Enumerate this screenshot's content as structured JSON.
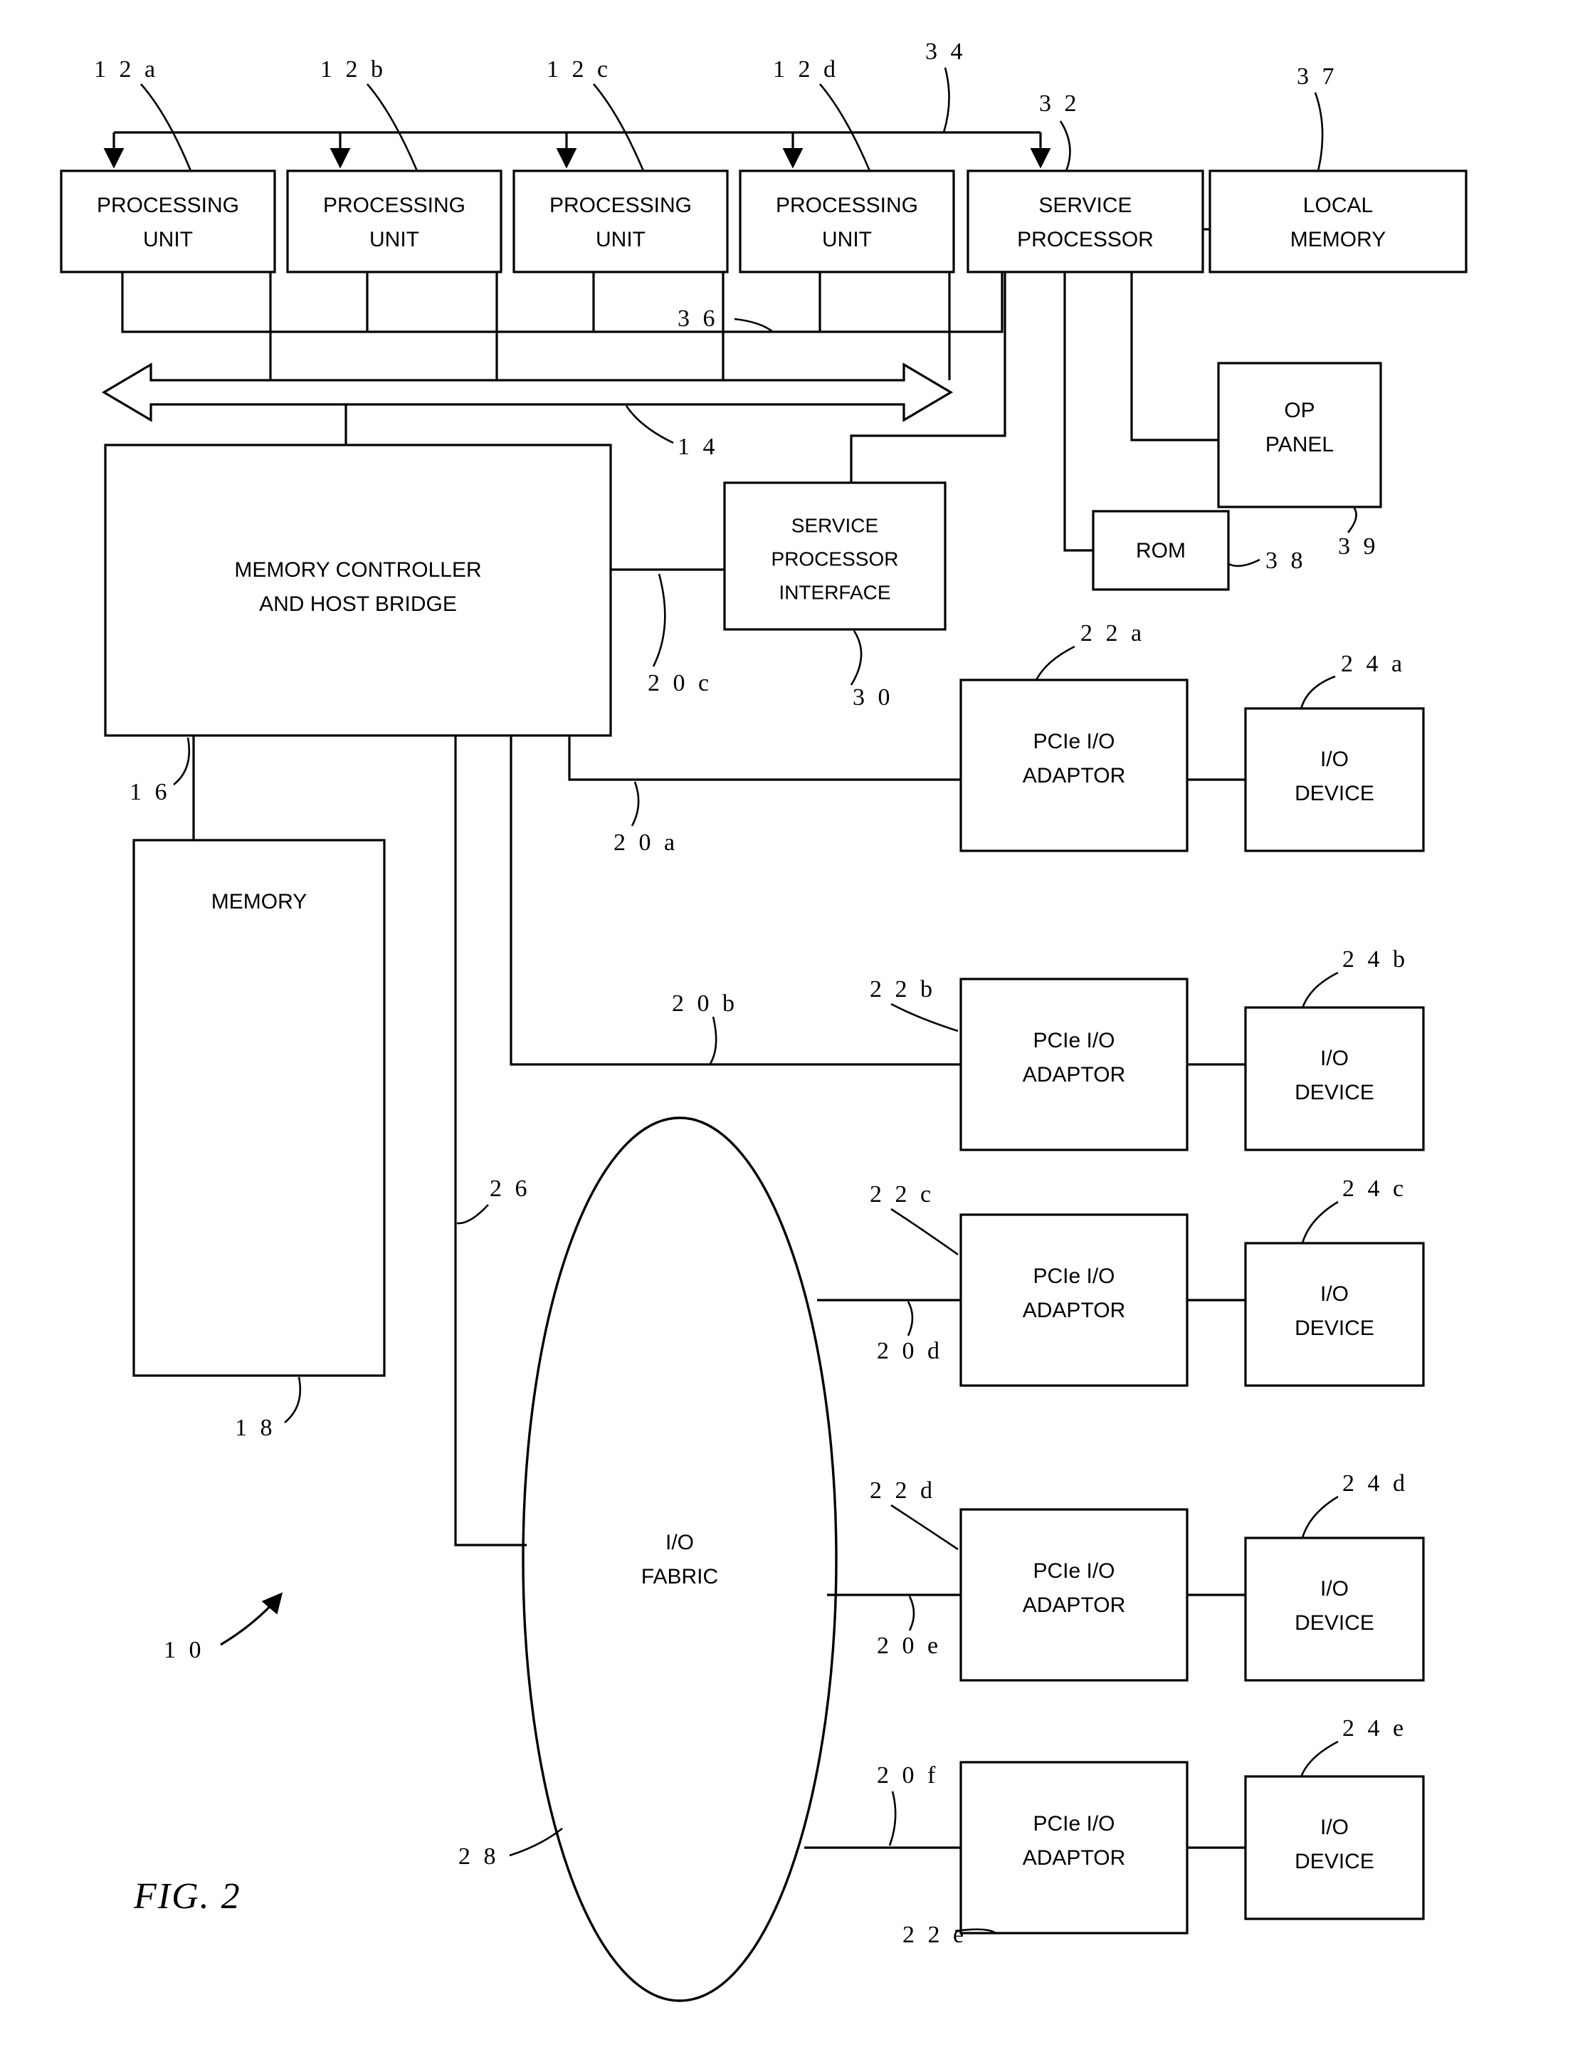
{
  "figure": {
    "caption": "FIG. 2",
    "system_ref": "1 0"
  },
  "blocks": {
    "processing_units": [
      {
        "line1": "PROCESSING",
        "line2": "UNIT",
        "ref": "1 2 a"
      },
      {
        "line1": "PROCESSING",
        "line2": "UNIT",
        "ref": "1 2 b"
      },
      {
        "line1": "PROCESSING",
        "line2": "UNIT",
        "ref": "1 2 c"
      },
      {
        "line1": "PROCESSING",
        "line2": "UNIT",
        "ref": "1 2 d"
      }
    ],
    "service_processor": {
      "line1": "SERVICE",
      "line2": "PROCESSOR",
      "ref": "3 2"
    },
    "local_memory": {
      "line1": "LOCAL",
      "line2": "MEMORY",
      "ref": "3 7"
    },
    "memory_controller": {
      "line1": "MEMORY CONTROLLER",
      "line2": "AND HOST BRIDGE",
      "ref": "1 6"
    },
    "memory": {
      "line1": "MEMORY",
      "ref": "1 8"
    },
    "service_processor_interface": {
      "line1": "SERVICE",
      "line2": "PROCESSOR",
      "line3": "INTERFACE",
      "ref": "3 0"
    },
    "op_panel": {
      "line1": "OP",
      "line2": "PANEL",
      "ref": "3 9"
    },
    "rom": {
      "line1": "ROM",
      "ref": "3 8"
    },
    "io_fabric": {
      "line1": "I/O",
      "line2": "FABRIC",
      "ref": "2 8"
    },
    "adapters": [
      {
        "line1": "PCIe I/O",
        "line2": "ADAPTOR",
        "ref": "2 2 a"
      },
      {
        "line1": "PCIe I/O",
        "line2": "ADAPTOR",
        "ref": "2 2 b"
      },
      {
        "line1": "PCIe I/O",
        "line2": "ADAPTOR",
        "ref": "2 2 c"
      },
      {
        "line1": "PCIe I/O",
        "line2": "ADAPTOR",
        "ref": "2 2 d"
      },
      {
        "line1": "PCIe I/O",
        "line2": "ADAPTOR",
        "ref": "2 2 e"
      }
    ],
    "devices": [
      {
        "line1": "I/O",
        "line2": "DEVICE",
        "ref": "2 4 a"
      },
      {
        "line1": "I/O",
        "line2": "DEVICE",
        "ref": "2 4 b"
      },
      {
        "line1": "I/O",
        "line2": "DEVICE",
        "ref": "2 4 c"
      },
      {
        "line1": "I/O",
        "line2": "DEVICE",
        "ref": "2 4 d"
      },
      {
        "line1": "I/O",
        "line2": "DEVICE",
        "ref": "2 4 e"
      }
    ]
  },
  "bus_refs": {
    "system_bus": "1 4",
    "sp_bus_top": "3 4",
    "sp_bus_mid": "3 6",
    "link_20a": "2 0 a",
    "link_20b": "2 0 b",
    "link_20c": "2 0 c",
    "link_20d": "2 0 d",
    "link_20e": "2 0 e",
    "link_20f": "2 0 f",
    "link_26": "2 6"
  }
}
